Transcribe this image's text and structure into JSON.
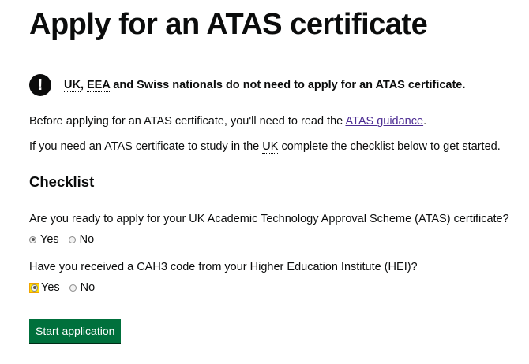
{
  "page": {
    "title": "Apply for an ATAS certificate"
  },
  "warning": {
    "icon": "exclamation-icon",
    "icon_glyph": "!",
    "abbr_uk": "UK",
    "sep1": ", ",
    "abbr_eea": "EEA",
    "rest": " and Swiss nationals do not need to apply for an ATAS certificate."
  },
  "intro": {
    "line1_before": "Before applying for an ",
    "line1_abbr": "ATAS",
    "line1_middle": " certificate, you'll need to read the ",
    "line1_link": "ATAS guidance",
    "line1_after": ".",
    "line2_before": "If you need an ATAS certificate to study in the ",
    "line2_abbr": "UK",
    "line2_after": " complete the checklist below to get started."
  },
  "checklist": {
    "heading": "Checklist",
    "questions": [
      {
        "text": "Are you ready to apply for your UK Academic Technology Approval Scheme (ATAS) certificate?",
        "options": [
          "Yes",
          "No"
        ],
        "selected": "Yes"
      },
      {
        "text": "Have you received a CAH3 code from your Higher Education Institute (HEI)?",
        "options": [
          "Yes",
          "No"
        ],
        "selected": "Yes"
      }
    ]
  },
  "actions": {
    "start_label": "Start application"
  },
  "colors": {
    "text": "#0b0c0c",
    "link": "#4c2c92",
    "button": "#00703c",
    "focus": "#ffdd00"
  }
}
